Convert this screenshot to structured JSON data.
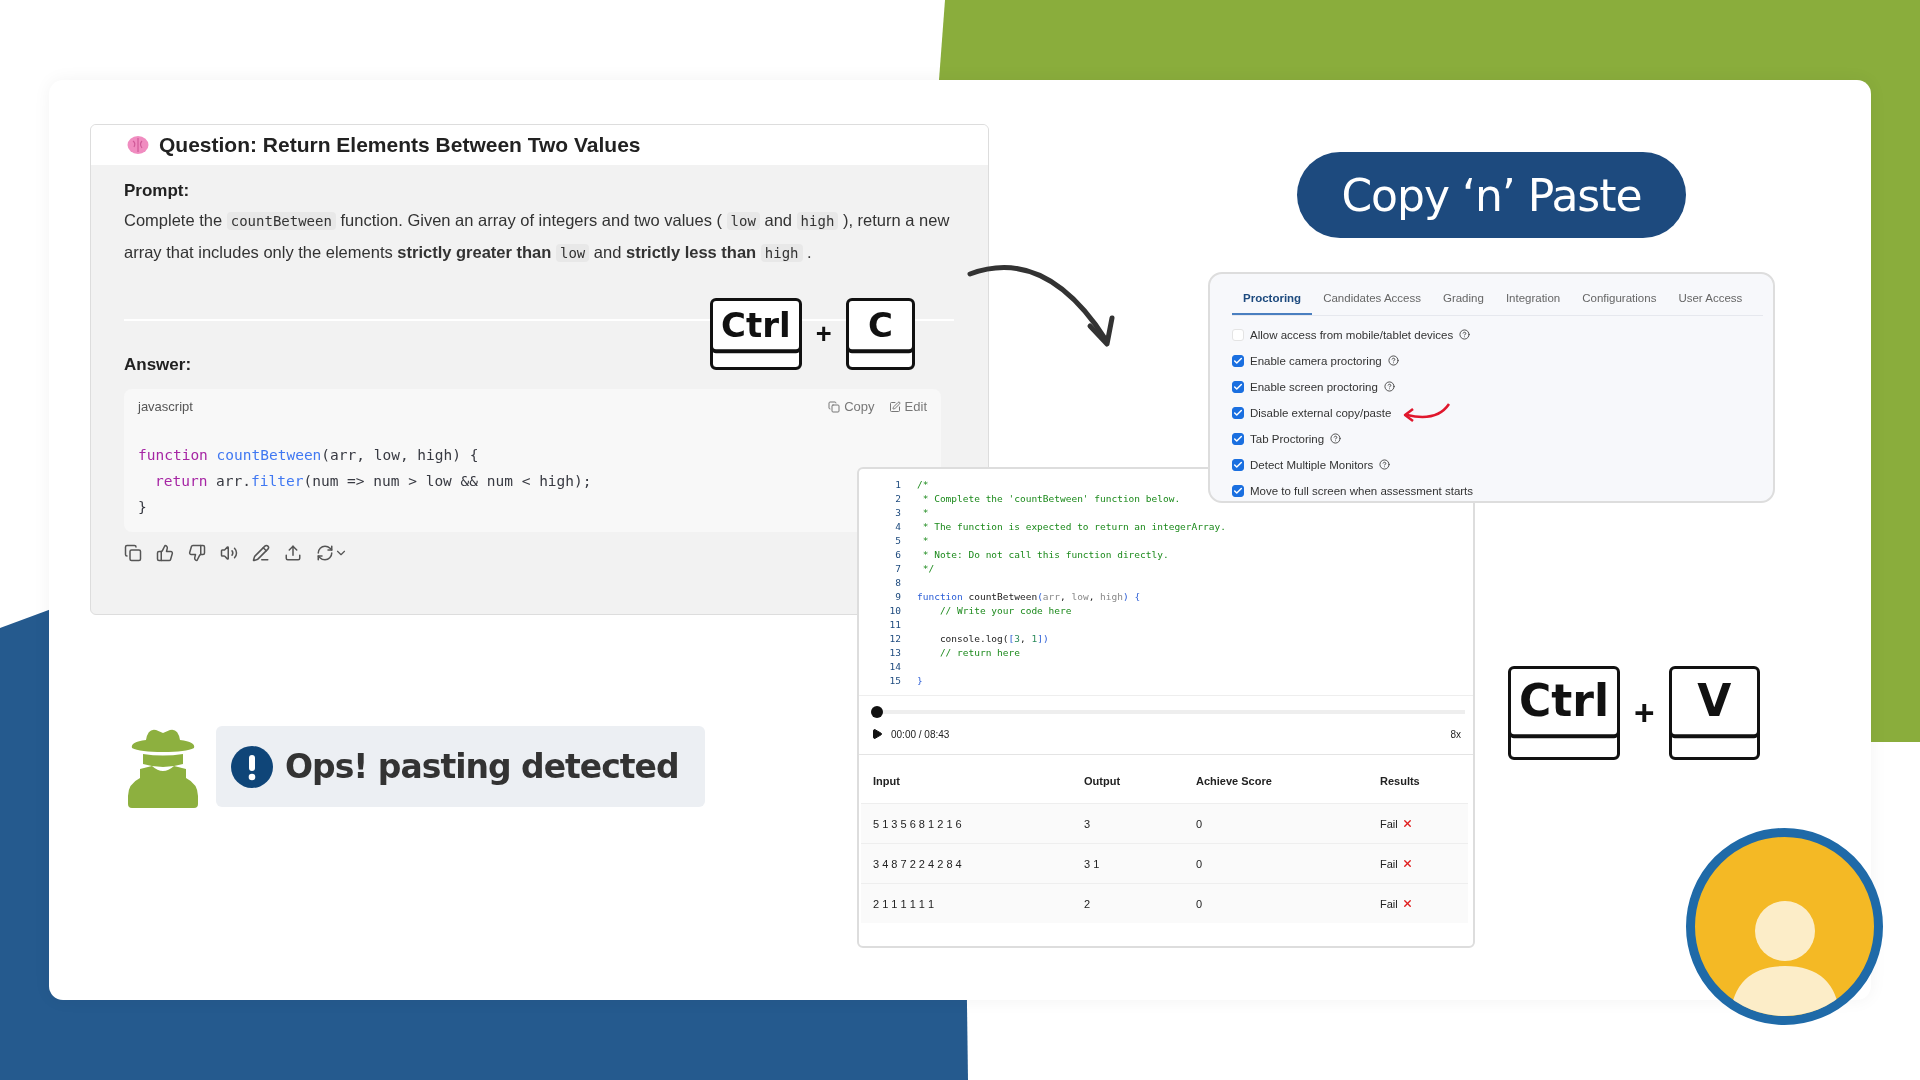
{
  "question_panel": {
    "title": "Question: Return Elements Between Two Values",
    "prompt_label": "Prompt:",
    "prompt": [
      {
        "kind": "text",
        "text": "Complete the "
      },
      {
        "kind": "code",
        "text": "countBetween"
      },
      {
        "kind": "text",
        "text": " function. Given an array of integers and two values ( "
      },
      {
        "kind": "code",
        "text": "low"
      },
      {
        "kind": "text",
        "text": " and "
      },
      {
        "kind": "code",
        "text": "high"
      },
      {
        "kind": "text",
        "text": " ), return a new array that includes only the elements "
      },
      {
        "kind": "bold",
        "text": "strictly greater than "
      },
      {
        "kind": "code",
        "text": "low"
      },
      {
        "kind": "text",
        "text": " and "
      },
      {
        "kind": "bold",
        "text": "strictly less than "
      },
      {
        "kind": "code",
        "text": "high"
      },
      {
        "kind": "text",
        "text": " ."
      }
    ],
    "answer_label": "Answer:",
    "code_block": {
      "language": "javascript",
      "copy": "Copy",
      "edit": "Edit",
      "lines": [
        {
          "indent": false,
          "tokens": [
            {
              "kind": "keyword",
              "text": "function "
            },
            {
              "kind": "function",
              "text": "countBetween"
            },
            {
              "kind": "plain",
              "text": "(arr, low, high) {"
            }
          ]
        },
        {
          "indent": true,
          "tokens": [
            {
              "kind": "keyword",
              "text": "return"
            },
            {
              "kind": "plain",
              "text": " arr."
            },
            {
              "kind": "function",
              "text": "filter"
            },
            {
              "kind": "plain",
              "text": "(num => num > low && num < high);"
            }
          ]
        },
        {
          "indent": false,
          "tokens": [
            {
              "kind": "plain",
              "text": "}"
            }
          ]
        }
      ]
    }
  },
  "copy_shortcut": {
    "keys": [
      "Ctrl",
      "C"
    ],
    "joiner": "+"
  },
  "headline": "Copy ‘n’ Paste",
  "settings": {
    "tabs": [
      {
        "label": "Proctoring",
        "selected": true
      },
      {
        "label": "Candidates Access",
        "selected": false
      },
      {
        "label": "Grading",
        "selected": false
      },
      {
        "label": "Integration",
        "selected": false
      },
      {
        "label": "Configurations",
        "selected": false
      },
      {
        "label": "User Access",
        "selected": false
      }
    ],
    "options": [
      {
        "label": "Allow access from mobile/tablet devices",
        "checked": false,
        "help": true,
        "pointed": false
      },
      {
        "label": "Enable camera proctoring",
        "checked": true,
        "help": true,
        "pointed": false
      },
      {
        "label": "Enable screen proctoring",
        "checked": true,
        "help": true,
        "pointed": false
      },
      {
        "label": "Disable external copy/paste",
        "checked": true,
        "help": false,
        "pointed": true
      },
      {
        "label": "Tab Proctoring",
        "checked": true,
        "help": true,
        "pointed": false
      },
      {
        "label": "Detect Multiple Monitors",
        "checked": true,
        "help": true,
        "pointed": false
      },
      {
        "label": "Move to full screen when assessment starts",
        "checked": true,
        "help": false,
        "pointed": false
      }
    ]
  },
  "editor": {
    "lines": [
      {
        "number": "1",
        "tokens": [
          {
            "kind": "comment",
            "text": "/*"
          }
        ]
      },
      {
        "number": "2",
        "tokens": [
          {
            "kind": "comment",
            "text": " * Complete the 'countBetween' function below."
          }
        ]
      },
      {
        "number": "3",
        "tokens": [
          {
            "kind": "comment",
            "text": " *"
          }
        ]
      },
      {
        "number": "4",
        "tokens": [
          {
            "kind": "comment",
            "text": " * The function is expected to return an integerArray."
          }
        ]
      },
      {
        "number": "5",
        "tokens": [
          {
            "kind": "comment",
            "text": " *"
          }
        ]
      },
      {
        "number": "6",
        "tokens": [
          {
            "kind": "comment",
            "text": " * Note: Do not call this function directly."
          }
        ]
      },
      {
        "number": "7",
        "tokens": [
          {
            "kind": "comment",
            "text": " */"
          }
        ]
      },
      {
        "number": "8"
      },
      {
        "number": "9",
        "tokens": [
          {
            "kind": "keyword",
            "text": "function"
          },
          {
            "kind": "plain",
            "text": " countBetween"
          },
          {
            "kind": "punct",
            "text": "("
          },
          {
            "kind": "param",
            "text": "arr"
          },
          {
            "kind": "plain",
            "text": ", "
          },
          {
            "kind": "param",
            "text": "low"
          },
          {
            "kind": "plain",
            "text": ", "
          },
          {
            "kind": "param",
            "text": "high"
          },
          {
            "kind": "punct",
            "text": ") {"
          }
        ]
      },
      {
        "number": "10",
        "tokens": [
          {
            "kind": "comment",
            "text": "    // Write your code here"
          }
        ]
      },
      {
        "number": "11"
      },
      {
        "number": "12",
        "tokens": [
          {
            "kind": "plain",
            "text": "    console.log("
          },
          {
            "kind": "punct",
            "text": "["
          },
          {
            "kind": "number",
            "text": "3"
          },
          {
            "kind": "plain",
            "text": ", "
          },
          {
            "kind": "number",
            "text": "1"
          },
          {
            "kind": "punct",
            "text": "])"
          }
        ]
      },
      {
        "number": "13",
        "tokens": [
          {
            "kind": "comment",
            "text": "    // return here"
          }
        ]
      },
      {
        "number": "14"
      },
      {
        "number": "15",
        "tokens": [
          {
            "kind": "punct",
            "text": "}"
          }
        ]
      }
    ],
    "playback": {
      "level": 0,
      "time": "00:00 / 08:43",
      "speed": "8x"
    }
  },
  "results_table": {
    "columns": [
      "Input",
      "Output",
      "Achieve Score",
      "Results"
    ],
    "rows": [
      {
        "cells": [
          "5 1 3 5 6 8 1 2 1 6",
          "3",
          "0",
          "Fail"
        ],
        "failed": true
      },
      {
        "cells": [
          "3 4 8 7 2 2 4 2 8 4",
          "3 1",
          "0",
          "Fail"
        ],
        "failed": true
      },
      {
        "cells": [
          "2 1 1 1 1 1 1",
          "2",
          "0",
          "Fail"
        ],
        "failed": true
      }
    ]
  },
  "paste_shortcut": {
    "keys": [
      "Ctrl",
      "V"
    ],
    "joiner": "+"
  },
  "alert": {
    "message": "Ops! pasting detected"
  }
}
